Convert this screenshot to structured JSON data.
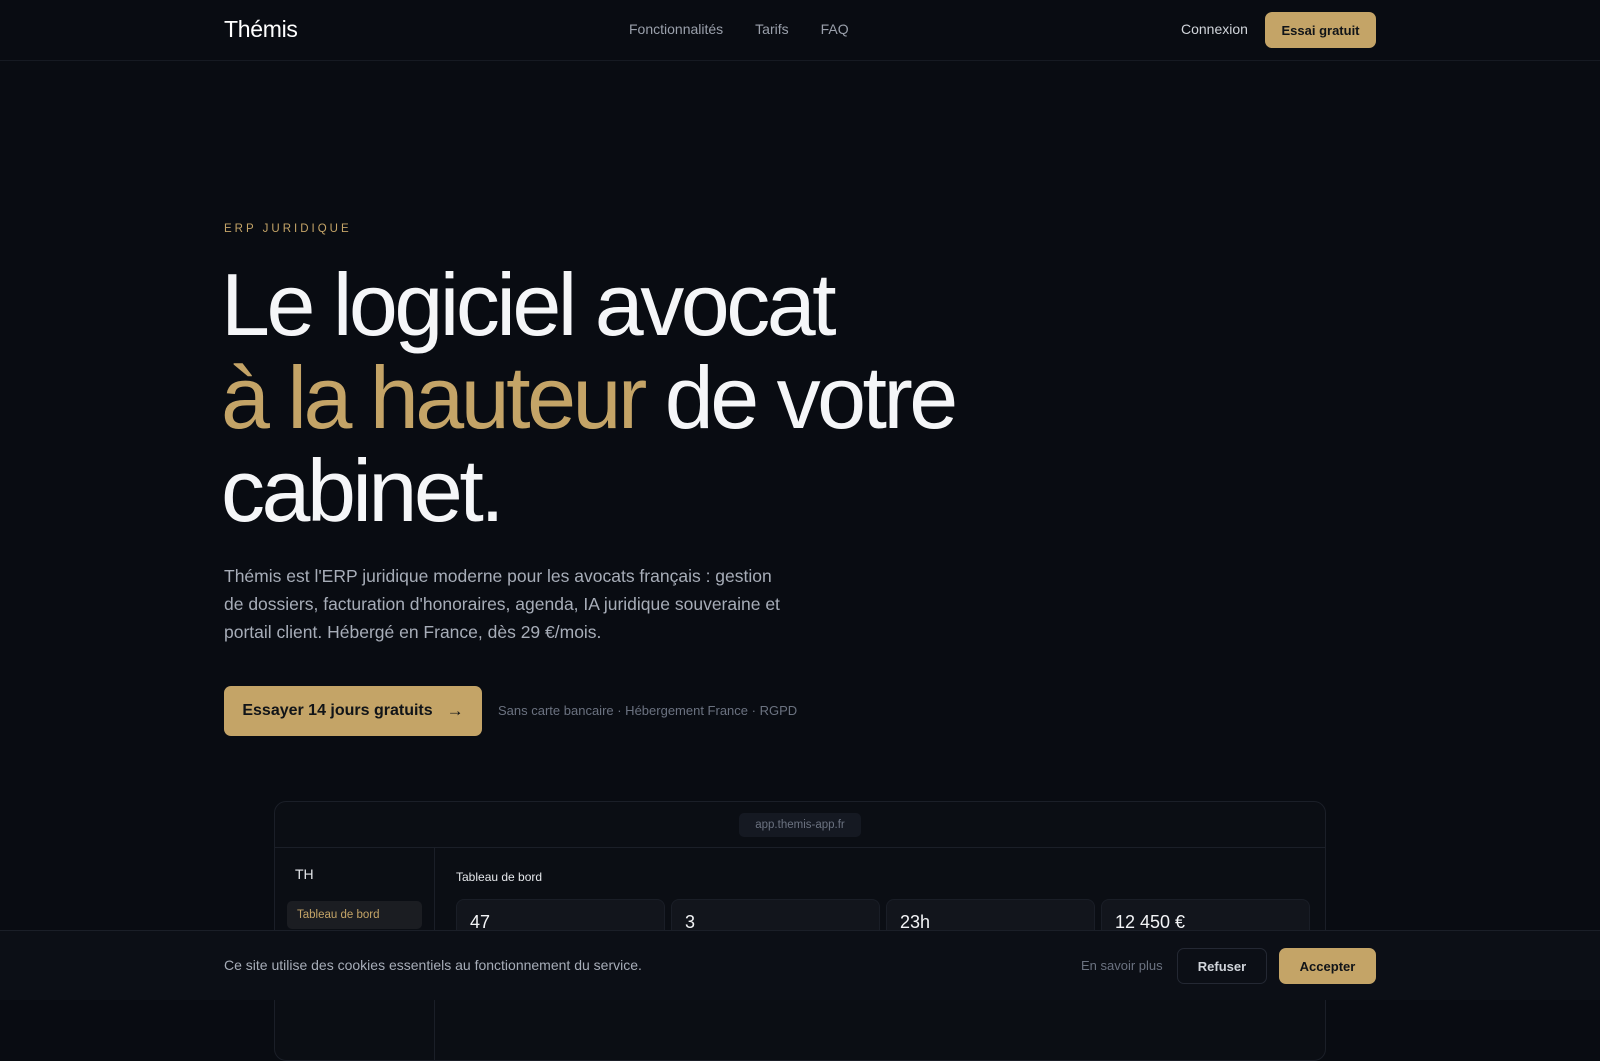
{
  "nav": {
    "logo": "Thémis",
    "links": [
      "Fonctionnalités",
      "Tarifs",
      "FAQ"
    ],
    "login": "Connexion",
    "cta": "Essai gratuit"
  },
  "hero": {
    "eyebrow": "ERP JURIDIQUE",
    "headline_line1": "Le logiciel avocat",
    "headline_accent": "à la hauteur",
    "headline_line2_rest": " de votre",
    "headline_line3": "cabinet.",
    "lead": "Thémis est l'ERP juridique moderne pour les avocats français : gestion de dossiers, facturation d'honoraires, agenda, IA juridique souveraine et portail client. Hébergé en France, dès 29 €/mois.",
    "cta": "Essayer 14 jours gratuits",
    "cta_icon": "arrow-right-icon",
    "reassurance": "Sans carte bancaire · Hébergement France · RGPD"
  },
  "preview": {
    "url": "app.themis-app.fr",
    "brand": "TH",
    "active_nav": "Tableau de bord",
    "title": "Tableau de bord",
    "kpis": [
      "47",
      "3",
      "23h",
      "12 450 €"
    ]
  },
  "cookie": {
    "text": "Ce site utilise des cookies essentiels au fonctionnement du service.",
    "more": "En savoir plus",
    "refuse": "Refuser",
    "accept": "Accepter"
  },
  "colors": {
    "background": "#090c12",
    "accent": "#c4a467",
    "text": "#f5f6f8",
    "muted": "#a7adb8"
  }
}
